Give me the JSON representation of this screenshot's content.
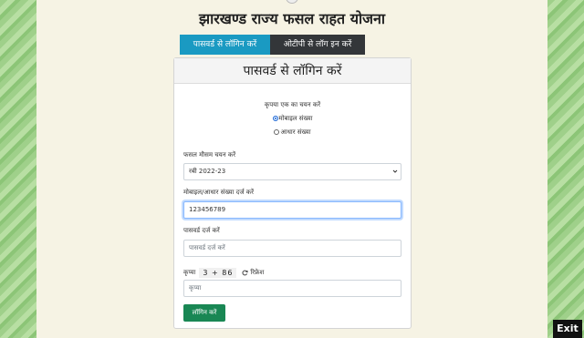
{
  "header": {
    "title": "झारखण्ड राज्य फसल राहत योजना"
  },
  "tabs": [
    {
      "label": "पासवर्ड से लॉगिन करें",
      "active": true
    },
    {
      "label": "ओटीपी से लॉग इन करें",
      "active": false
    }
  ],
  "card": {
    "title": "पासवर्ड से लॉगिन करें",
    "choose_label": "कृपया एक का चयन करें",
    "radios": [
      {
        "label": "मोबाइल संख्या",
        "checked": true
      },
      {
        "label": "आधार संख्या",
        "checked": false
      }
    ],
    "season_label": "फसल मौसम चयन करें",
    "season_value": "रबी 2022-23",
    "mobile_label": "मोबाइल/आधार संख्या दर्ज करें",
    "mobile_value": "123456789",
    "password_label": "पासवर्ड दर्ज करें",
    "password_placeholder": "पासवर्ड दर्ज करें",
    "captcha_label": "कृप्या",
    "captcha_value": "3 + 86",
    "refresh_label": "रिफ्रेश",
    "captcha_placeholder": "कृप्या",
    "login_button": "लॉगिन करें"
  },
  "exit_label": "Exit",
  "colors": {
    "tab_active": "#1a9ac2",
    "tab_inactive": "#333639",
    "login_button": "#198754"
  }
}
